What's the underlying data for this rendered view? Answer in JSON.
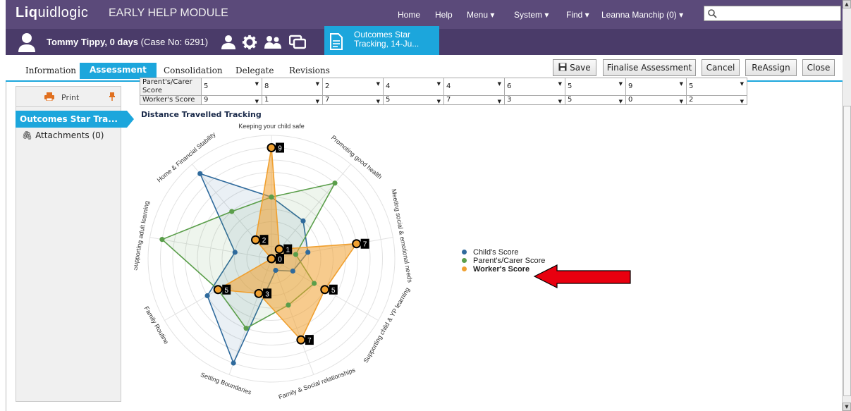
{
  "app": {
    "logo_a": "Liq",
    "logo_b": "uidlogic",
    "module": "EARLY HELP MODULE"
  },
  "topnav": {
    "home": "Home",
    "help": "Help",
    "menu": "Menu ▾",
    "system": "System ▾",
    "find": "Find ▾",
    "user": "Leanna Manchip (0) ▾",
    "search_placeholder": ""
  },
  "case": {
    "name": "Tommy Tippy, 0 days",
    "case_no": "(Case No: 6291)",
    "tab_title_1": "Outcomes Star",
    "tab_title_2": "Tracking, 14-Ju..."
  },
  "tabs": [
    "Information",
    "Assessment",
    "Consolidation",
    "Delegate",
    "Revisions"
  ],
  "actions": {
    "save": "Save",
    "finalise": "Finalise Assessment",
    "cancel": "Cancel",
    "reassign": "ReAssign",
    "close": "Close"
  },
  "left": {
    "print": "Print",
    "active": "Outcomes Star Tra...",
    "attachments": "Attachments (0)"
  },
  "table": {
    "rows": [
      {
        "label": "Parent's/Carer Score",
        "values": [
          "5",
          "8",
          "2",
          "4",
          "4",
          "6",
          "5",
          "9",
          "5"
        ]
      },
      {
        "label": "Worker's Score",
        "values": [
          "9",
          "1",
          "7",
          "5",
          "7",
          "3",
          "5",
          "0",
          "2"
        ]
      }
    ]
  },
  "section_title": "Distance Travelled Tracking",
  "colors": {
    "child": "#2f6a9c",
    "parent": "#5a9e4a",
    "worker": "#f0a030",
    "accent": "#1ca6dc",
    "header": "#5b4a7a"
  },
  "chart_data": {
    "type": "radar",
    "categories": [
      "Keeping your child safe",
      "Promoting good health",
      "Meeting social & emotional needs",
      "Supporting child & YP learning",
      "Family & Social relationships",
      "Setting Boundaries",
      "Family Routine",
      "Supporting adult learning",
      "Home & Financial Stability"
    ],
    "rmax": 10,
    "series": [
      {
        "name": "Child's Score",
        "values": [
          5,
          4,
          3,
          2,
          1,
          9,
          6,
          3,
          9
        ]
      },
      {
        "name": "Parent's/Carer Score",
        "values": [
          5,
          8,
          2,
          4,
          4,
          6,
          5,
          9,
          5
        ]
      },
      {
        "name": "Worker's Score",
        "values": [
          9,
          1,
          7,
          5,
          7,
          3,
          5,
          0,
          2
        ]
      }
    ],
    "point_labels": [
      "9",
      "1",
      "7",
      "5",
      "7",
      "3",
      "5",
      "0",
      "2"
    ],
    "legend_position": "right"
  }
}
